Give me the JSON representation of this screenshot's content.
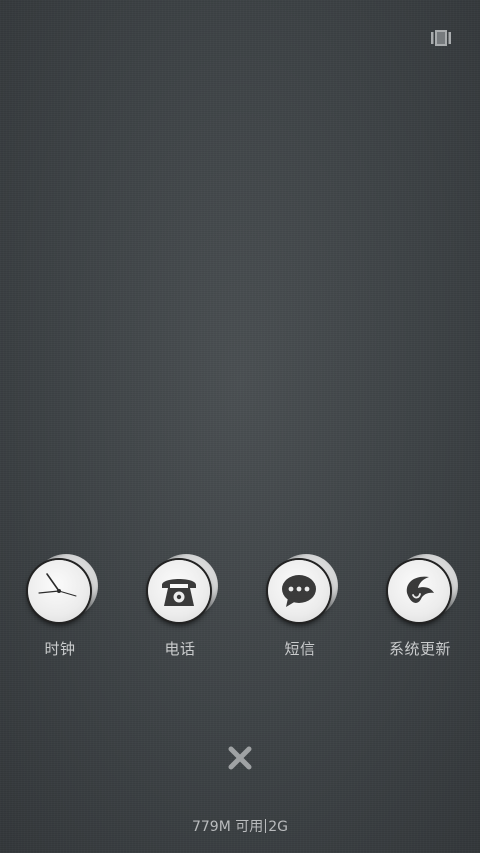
{
  "top_bar": {
    "clear_all_icon": "card-stack-icon"
  },
  "recent_apps": [
    {
      "label": "时钟",
      "icon": "clock-icon"
    },
    {
      "label": "电话",
      "icon": "telephone-icon"
    },
    {
      "label": "短信",
      "icon": "chat-bubble-icon"
    },
    {
      "label": "系统更新",
      "icon": "leaf-update-icon"
    }
  ],
  "close_button": {
    "icon": "close-icon"
  },
  "status": {
    "memory": "779M 可用",
    "network": "2G"
  },
  "colors": {
    "background": "#3d4245",
    "label_text": "#c9cbcc",
    "icon_dark": "#3a3a3a"
  }
}
